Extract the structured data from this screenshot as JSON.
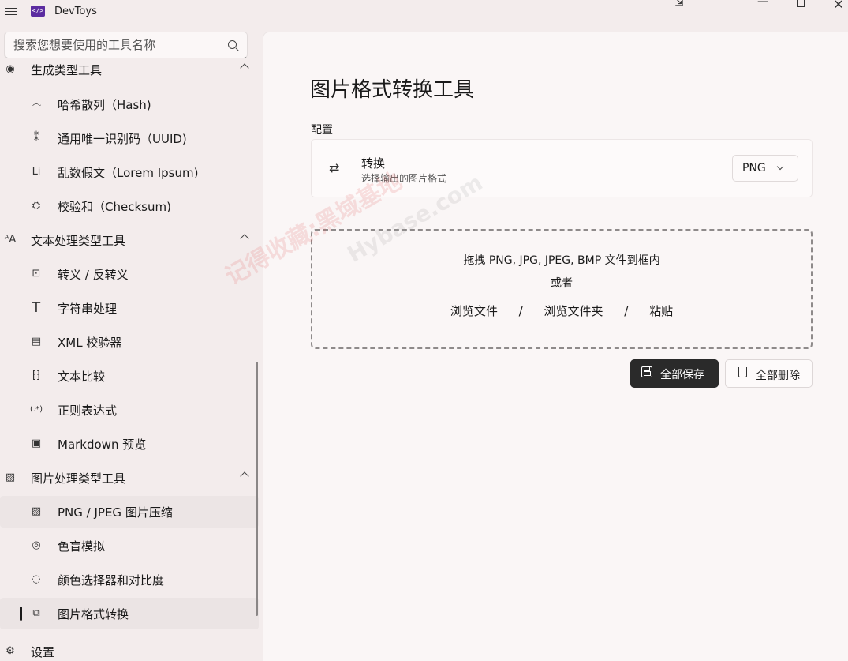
{
  "app": {
    "title": "DevToys"
  },
  "search": {
    "placeholder": "搜索您想要使用的工具名称"
  },
  "sidebar": {
    "items": [
      {
        "label": "生成类型工具",
        "icon": "fingerprint-icon",
        "type": "group",
        "expanded": true
      },
      {
        "label": "哈希散列（Hash)",
        "icon": "fingerprint-icon",
        "type": "child"
      },
      {
        "label": "通用唯一识别码（UUID)",
        "icon": "uuid-icon",
        "type": "child"
      },
      {
        "label": "乱数假文（Lorem Ipsum)",
        "icon": "lorem-icon",
        "glyph": "Li",
        "type": "child"
      },
      {
        "label": "校验和（Checksum)",
        "icon": "checksum-icon",
        "type": "child"
      },
      {
        "label": "文本处理类型工具",
        "icon": "text-icon",
        "type": "group",
        "expanded": true
      },
      {
        "label": "转义 / 反转义",
        "icon": "escape-icon",
        "type": "child"
      },
      {
        "label": "字符串处理",
        "icon": "text-t-icon",
        "glyph": "T",
        "type": "child"
      },
      {
        "label": "XML 校验器",
        "icon": "xml-validator-icon",
        "type": "child"
      },
      {
        "label": "文本比较",
        "icon": "text-diff-icon",
        "type": "child"
      },
      {
        "label": "正则表达式",
        "icon": "regex-icon",
        "glyph": "(.*)",
        "type": "child"
      },
      {
        "label": "Markdown 预览",
        "icon": "markdown-icon",
        "type": "child"
      },
      {
        "label": "图片处理类型工具",
        "icon": "image-icon",
        "type": "group",
        "expanded": true
      },
      {
        "label": "PNG / JPEG 图片压缩",
        "icon": "image-compress-icon",
        "type": "child"
      },
      {
        "label": "色盲模拟",
        "icon": "eye-icon",
        "type": "child"
      },
      {
        "label": "颜色选择器和对比度",
        "icon": "color-picker-icon",
        "type": "child"
      },
      {
        "label": "图片格式转换",
        "icon": "image-convert-icon",
        "type": "child",
        "selected": true
      },
      {
        "label": "设置",
        "icon": "gear-icon",
        "type": "group"
      }
    ]
  },
  "main": {
    "title": "图片格式转换工具",
    "config_label": "配置",
    "convert": {
      "title": "转换",
      "subtitle": "选择输出的图片格式",
      "format_value": "PNG"
    },
    "dropzone": {
      "line1": "拖拽 PNG, JPG, JPEG, BMP 文件到框内",
      "line2": "或者",
      "browse_files": "浏览文件",
      "browse_folder": "浏览文件夹",
      "paste": "粘贴",
      "sep": "/"
    },
    "buttons": {
      "save_all": "全部保存",
      "delete_all": "全部删除"
    }
  },
  "watermark": {
    "text1": "记得收藏:黑域基地",
    "text2": "Hybase.com"
  }
}
